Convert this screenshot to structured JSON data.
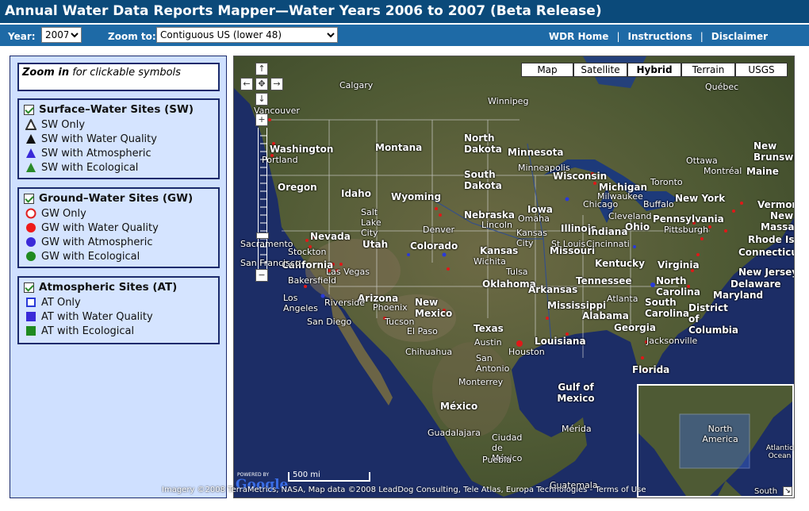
{
  "title": "Annual Water Data Reports Mapper—Water Years 2006 to 2007 (Beta Release)",
  "toolbar": {
    "year_label": "Year:",
    "year_value": "2007",
    "zoom_label": "Zoom to:",
    "zoom_value": "Contiguous US (lower 48)",
    "links": [
      "WDR Home",
      "Instructions",
      "Disclaimer"
    ],
    "separator": "|"
  },
  "legend": {
    "hint_bold": "Zoom in",
    "hint_rest": " for clickable symbols",
    "groups": [
      {
        "title": "Surface–Water Sites (SW)",
        "items": [
          "SW Only",
          "SW with Water Quality",
          "SW with Atmospheric",
          "SW with Ecological"
        ]
      },
      {
        "title": "Ground–Water Sites (GW)",
        "items": [
          "GW Only",
          "GW with Water Quality",
          "GW with Atmospheric",
          "GW with Ecological"
        ]
      },
      {
        "title": "Atmospheric Sites (AT)",
        "items": [
          "AT Only",
          "AT with Water Quality",
          "AT with Ecological"
        ]
      }
    ]
  },
  "map": {
    "types": [
      "Map",
      "Satellite",
      "Hybrid",
      "Terrain",
      "USGS"
    ],
    "active_type": "Hybrid",
    "scale_label": "500 mi",
    "google_logo": "Google",
    "powered_by": "POWERED BY",
    "attribution": "Imagery ©2008 TerraMetrics, NASA, Map data ©2008 LeadDog Consulting, Tele Atlas, Europa Technologies - Terms of Use",
    "labels": {
      "calgary": "Calgary",
      "winnipeg": "Winnipeg",
      "quebec": "Québec",
      "vancouver": "Vancouver",
      "washington": "Washington",
      "montana": "Montana",
      "north_dakota": "North Dakota",
      "minnesota": "Minnesota",
      "portland": "Portland",
      "minneapolis": "Minneapolis",
      "wisconsin": "Wisconsin",
      "michigan": "Michigan",
      "toronto": "Toronto",
      "ottawa": "Ottawa",
      "montreal": "Montréal",
      "maine": "Maine",
      "oregon": "Oregon",
      "idaho": "Idaho",
      "wyoming": "Wyoming",
      "south_dakota": "South Dakota",
      "iowa": "Iowa",
      "new_york": "New York",
      "salt_lake_city": "Salt Lake City",
      "nebraska": "Nebraska",
      "chicago": "Chicago",
      "buffalo": "Buffalo",
      "pennsylvania": "Pennsylvania",
      "nevada": "Nevada",
      "utah": "Utah",
      "denver": "Denver",
      "colorado": "Colorado",
      "kansas": "Kansas",
      "illinois": "Illinois",
      "indiana": "Indiana",
      "ohio": "Ohio",
      "california": "California",
      "sacramento": "Sacramento",
      "san_francisco": "San Francisco",
      "missouri": "Missouri",
      "kentucky": "Kentucky",
      "virginia": "Virginia",
      "connecticut": "Connecticut",
      "new_jersey": "New Jersey",
      "delaware": "Delaware",
      "maryland": "Maryland",
      "dc": "District of Columbia",
      "las_vegas": "Las Vegas",
      "bakersfield": "Bakersfield",
      "oklahoma": "Oklahoma",
      "arkansas": "Arkansas",
      "tennessee": "Tennessee",
      "north_carolina": "North Carolina",
      "los_angeles": "Los Angeles",
      "arizona": "Arizona",
      "new_mexico": "New Mexico",
      "mississippi": "Mississippi",
      "alabama": "Alabama",
      "south_carolina": "South Carolina",
      "san_diego": "San Diego",
      "phoenix": "Phoenix",
      "tucson": "Tucson",
      "el_paso": "El Paso",
      "texas": "Texas",
      "georgia": "Georgia",
      "atlanta": "Atlanta",
      "austin": "Austin",
      "houston": "Houston",
      "louisiana": "Louisiana",
      "san_antonio": "San Antonio",
      "jacksonville": "Jacksonville",
      "chihuahua": "Chihuahua",
      "florida": "Florida",
      "monterrey": "Monterrey",
      "gulf_of_mexico": "Gulf of Mexico",
      "mexico": "México",
      "guadalajara": "Guadalajara",
      "ciudad_de_mexico": "Ciudad de México",
      "puebla": "Puebla",
      "merida": "Mérida",
      "guatemala": "Guatemala",
      "new_brunswick": "New Brunswick",
      "vermont": "Vermont",
      "massachusetts": "Massachusetts",
      "rhode_island": "Rhode Island",
      "cleveland": "Cleveland",
      "pittsburgh": "Pittsburgh",
      "lincoln": "Lincoln",
      "omaha": "Omaha",
      "kansas_city": "Kansas City",
      "st_louis": "St Louis",
      "cincinnati": "Cincinnati",
      "wichita": "Wichita",
      "tulsa": "Tulsa",
      "stockton": "Stockton",
      "riverside": "Riverside",
      "milwaukee": "Milwaukee"
    },
    "overview": {
      "north_america": "North America",
      "atlantic_ocean": "Atlantic Ocean",
      "south": "South"
    }
  }
}
